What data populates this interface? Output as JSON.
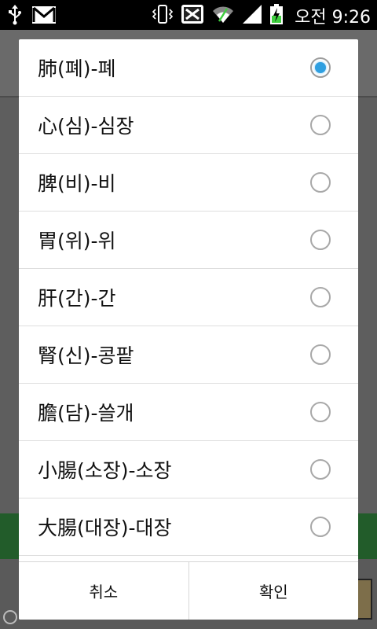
{
  "status_bar": {
    "time": "오전 9:26",
    "left_icons": [
      "usb-icon",
      "gmail-icon"
    ],
    "right_icons": [
      "vibrate-icon",
      "app-notification-icon",
      "wifi-icon",
      "signal-icon",
      "battery-charging-icon"
    ]
  },
  "dialog": {
    "options": [
      {
        "label": "肺(폐)-폐",
        "checked": true
      },
      {
        "label": "心(심)-심장",
        "checked": false
      },
      {
        "label": "脾(비)-비",
        "checked": false
      },
      {
        "label": "胃(위)-위",
        "checked": false
      },
      {
        "label": "肝(간)-간",
        "checked": false
      },
      {
        "label": "腎(신)-콩팥",
        "checked": false
      },
      {
        "label": "膽(담)-쓸개",
        "checked": false
      },
      {
        "label": "小腸(소장)-소장",
        "checked": false
      },
      {
        "label": "大腸(대장)-대장",
        "checked": false
      }
    ],
    "cancel_label": "취소",
    "ok_label": "확인"
  },
  "colors": {
    "radio_selected": "#2f9fe0",
    "background_green": "#225c2a"
  }
}
